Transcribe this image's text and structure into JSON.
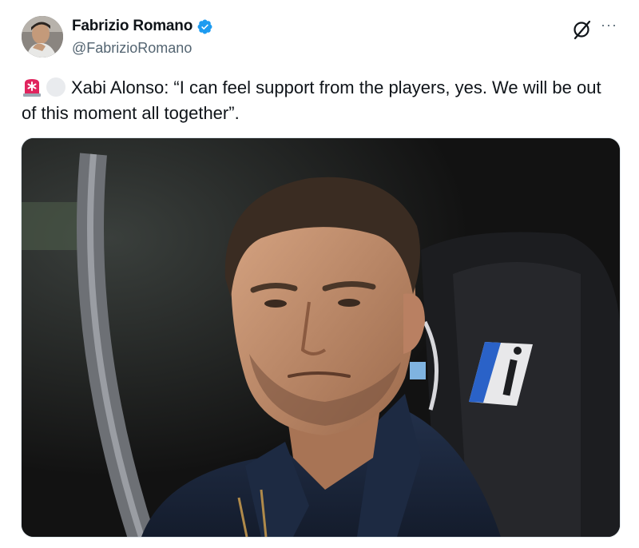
{
  "tweet": {
    "author_name": "Fabrizio Romano",
    "author_handle": "@FabrizioRomano",
    "verified": true,
    "text": "Xabi Alonso: “I can feel support from the players, yes. We will be out of this moment all together”.",
    "leading_emojis": [
      "siren-emoji",
      "white-circle-emoji"
    ]
  },
  "icons": {
    "grok": "grok-icon",
    "more": "more-icon",
    "verified": "verified-badge-icon"
  },
  "colors": {
    "verified_blue": "#1d9bf0",
    "text_primary": "#0f1419",
    "text_secondary": "#536471"
  },
  "more_label": "···"
}
